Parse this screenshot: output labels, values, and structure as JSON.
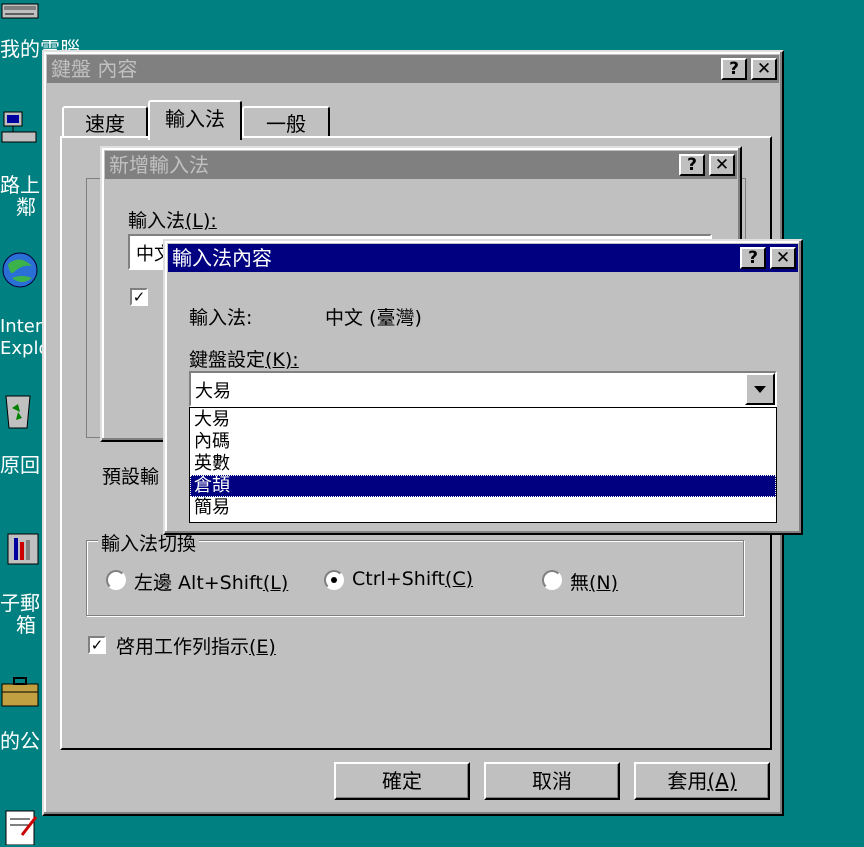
{
  "desktop": {
    "icons": [
      {
        "name": "my-computer",
        "label": "我的電腦"
      },
      {
        "name": "network",
        "label": "網路上的芳鄰"
      },
      {
        "name": "internet-explorer",
        "label": "Internet Explorer"
      },
      {
        "name": "recycle-bin",
        "label": "資源回收筒"
      },
      {
        "name": "inbox",
        "label": "電子郵件收件箱"
      },
      {
        "name": "briefcase",
        "label": "我的公事包"
      }
    ],
    "label_fragments": {
      "computer": "我的電腦",
      "network_1": "路上",
      "network_2": "鄰",
      "ie_1": "Intern",
      "ie_2": "Explo",
      "recycle": "原回",
      "mail_1": "子郵",
      "mail_2": "箱",
      "briefcase": "的公"
    }
  },
  "keyboard_window": {
    "title": "鍵盤 內容",
    "tabs": [
      "速度",
      "輸入法",
      "一般"
    ],
    "active_tab": 1,
    "default_label": "預設輸",
    "switch_group": {
      "label": "輸入法切換",
      "options": [
        {
          "label": "左邊 Alt+Shift",
          "hotkey": "(L)",
          "selected": false
        },
        {
          "label": "Ctrl+Shift",
          "hotkey": "(C)",
          "selected": true
        },
        {
          "label": "無",
          "hotkey": "(N)",
          "selected": false
        }
      ]
    },
    "taskbar_indicator": {
      "label": "啓用工作列指示",
      "hotkey": "(E)",
      "checked": true
    },
    "buttons": {
      "ok": "確定",
      "cancel": "取消",
      "apply": "套用",
      "apply_hotkey": "(A)"
    }
  },
  "add_ime_window": {
    "title": "新增輸入法",
    "field_label": "輸入法",
    "field_hotkey": "(L):",
    "field_value": "中文",
    "checkbox_checked": true
  },
  "ime_props_window": {
    "title": "輸入法內容",
    "ime_label": "輸入法:",
    "ime_value": "中文 (臺灣)",
    "keyboard_label": "鍵盤設定",
    "keyboard_hotkey": "(K):",
    "selected_value": "大易",
    "dropdown_options": [
      "大易",
      "內碼",
      "英數",
      "倉頡",
      "簡易"
    ],
    "highlighted_index": 3
  },
  "colors": {
    "desktop": "#008080",
    "face": "#c0c0c0",
    "active_title": "#000080",
    "inactive_title": "#808080"
  }
}
